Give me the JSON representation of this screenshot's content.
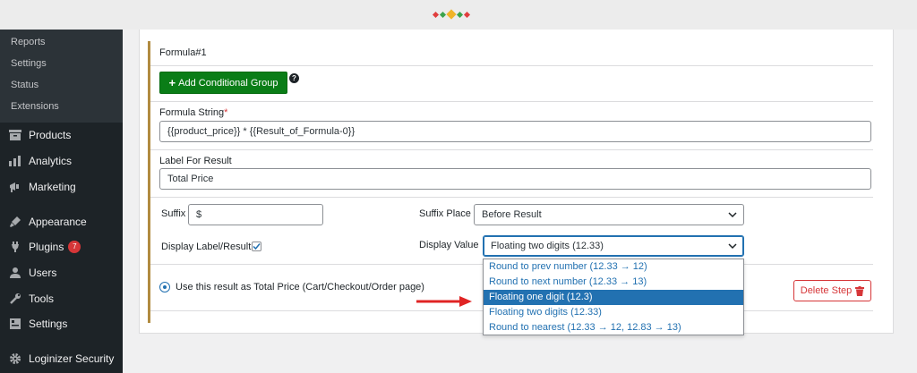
{
  "colors": {
    "accent": "#2271b1",
    "green": "#0a7d17",
    "danger": "#d63638",
    "sidebar": "#1d2327",
    "formula_border": "#b18b40"
  },
  "sidebar": {
    "submenu": [
      "Reports",
      "Settings",
      "Status",
      "Extensions"
    ],
    "items": [
      {
        "label": "Products",
        "icon": "products-icon"
      },
      {
        "label": "Analytics",
        "icon": "analytics-icon"
      },
      {
        "label": "Marketing",
        "icon": "marketing-icon"
      },
      {
        "label": "Appearance",
        "icon": "appearance-icon"
      },
      {
        "label": "Plugins",
        "icon": "plugins-icon",
        "badge": "7"
      },
      {
        "label": "Users",
        "icon": "users-icon"
      },
      {
        "label": "Tools",
        "icon": "tools-icon"
      },
      {
        "label": "Settings",
        "icon": "settings-icon"
      },
      {
        "label": "Loginizer Security",
        "icon": "gear-icon"
      }
    ]
  },
  "formula": {
    "title": "Formula#1",
    "add_group_label": "Add Conditional Group",
    "help_symbol": "?",
    "formula_string_label": "Formula String",
    "required_mark": "*",
    "formula_string_value": "{{product_price}} * {{Result_of_Formula-0}}",
    "label_for_result_label": "Label For Result",
    "label_for_result_value": "Total Price",
    "suffix_label": "Suffix",
    "suffix_value": "$",
    "suffix_place_label": "Suffix Place",
    "suffix_place_value": "Before Result",
    "display_label_result_label": "Display Label/Result",
    "display_label_result_checked": true,
    "display_value_label": "Display Value",
    "display_value_selected": "Floating two digits (12.33)",
    "display_value_options": [
      "Round to prev number (12.33 → 12)",
      "Round to next number (12.33 → 13)",
      "Floating one digit (12.3)",
      "Floating two digits (12.33)",
      "Round to nearest (12.33 → 12, 12.83 → 13)"
    ],
    "highlighted_option": "Floating one digit (12.3)",
    "use_total_label": "Use this result as Total Price (Cart/Checkout/Order page)",
    "delete_label": "Delete Step"
  }
}
